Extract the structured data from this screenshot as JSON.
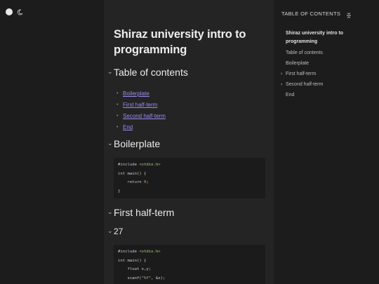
{
  "theme": {
    "toggle_icon": "moon-icon"
  },
  "page": {
    "title": "Shiraz university intro to programming"
  },
  "sections": {
    "toc_heading": "Table of contents",
    "toc_links": [
      "Boilerplate",
      "First half-term",
      "Second half-term",
      "End"
    ],
    "boilerplate_heading": "Boilerplate",
    "first_half_heading": "First half-term",
    "sub_27_heading": "27"
  },
  "code": {
    "boilerplate": {
      "line1_pp": "#include",
      "line1_hdr": "<stdio.h>",
      "line2_kw": "int",
      "line2_rest": " main() {",
      "line3_kw": "    return",
      "line3_num": "0",
      "line3_end": ";",
      "line4": "}"
    },
    "sample27": {
      "line1_pp": "#include",
      "line1_hdr": "<stdio.h>",
      "line2_kw": "int",
      "line2_rest": " main() {",
      "line3_kw": "    float",
      "line3_rest": " x,y;",
      "line4_pre": "    scanf(",
      "line4_str": "\"%f\"",
      "line4_post": ", &x);"
    }
  },
  "right_panel": {
    "title": "TABLE OF CONTENTS",
    "items": [
      {
        "label": "Shiraz university intro to programming",
        "active": true,
        "expandable": false
      },
      {
        "label": "Table of contents",
        "active": false,
        "expandable": false
      },
      {
        "label": "Boilerplate",
        "active": false,
        "expandable": false
      },
      {
        "label": "First half-term",
        "active": false,
        "expandable": true
      },
      {
        "label": "Second half-term",
        "active": false,
        "expandable": true
      },
      {
        "label": "End",
        "active": false,
        "expandable": false
      }
    ]
  },
  "colors": {
    "link": "#9b8cf0",
    "main_bg": "#242424",
    "side_bg": "#1c1c1c",
    "code_bg": "#1b1b1b"
  }
}
